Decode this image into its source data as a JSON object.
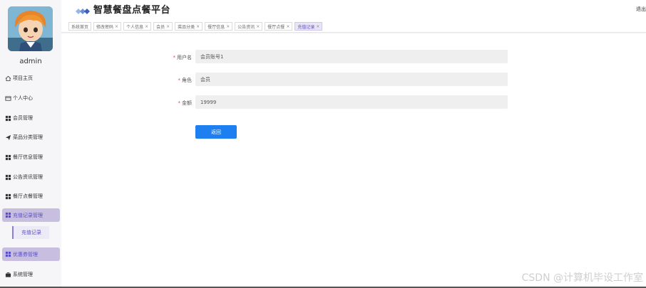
{
  "header": {
    "title": "智慧餐盘点餐平台",
    "logout_label": "退出"
  },
  "user": {
    "name": "admin"
  },
  "sidebar": {
    "items": [
      {
        "label": "项目主页",
        "icon": "home-icon"
      },
      {
        "label": "个人中心",
        "icon": "user-card-icon"
      },
      {
        "label": "会员管理",
        "icon": "grid-icon"
      },
      {
        "label": "菜品分类管理",
        "icon": "send-icon"
      },
      {
        "label": "餐厅信息管理",
        "icon": "grid-icon"
      },
      {
        "label": "公告资讯管理",
        "icon": "grid-icon"
      },
      {
        "label": "餐厅点餐管理",
        "icon": "grid-icon"
      },
      {
        "label": "充值记录管理",
        "icon": "grid-icon"
      },
      {
        "label": "优惠券管理",
        "icon": "grid-icon"
      },
      {
        "label": "系统管理",
        "icon": "briefcase-icon"
      }
    ],
    "sub_item": "充值记录"
  },
  "tabs": [
    {
      "label": "系统首页",
      "closable": false
    },
    {
      "label": "修改密码",
      "closable": true
    },
    {
      "label": "个人信息",
      "closable": true
    },
    {
      "label": "会员",
      "closable": true
    },
    {
      "label": "菜品分类",
      "closable": true
    },
    {
      "label": "餐厅信息",
      "closable": true
    },
    {
      "label": "公告资讯",
      "closable": true
    },
    {
      "label": "餐厅点餐",
      "closable": true
    },
    {
      "label": "充值记录",
      "closable": true
    }
  ],
  "close_glyph": "×",
  "form": {
    "required_mark": "*",
    "username_label": "用户名",
    "username_value": "会员账号1",
    "role_label": "角色",
    "role_value": "会员",
    "amount_label": "金额",
    "amount_value": "19999",
    "back_label": "返回"
  },
  "watermark": "CSDN @计算机毕设工作室",
  "colors": {
    "accent": "#5b4fc0",
    "active_bg": "#c8bfe0",
    "primary_button": "#1e7ff0"
  }
}
